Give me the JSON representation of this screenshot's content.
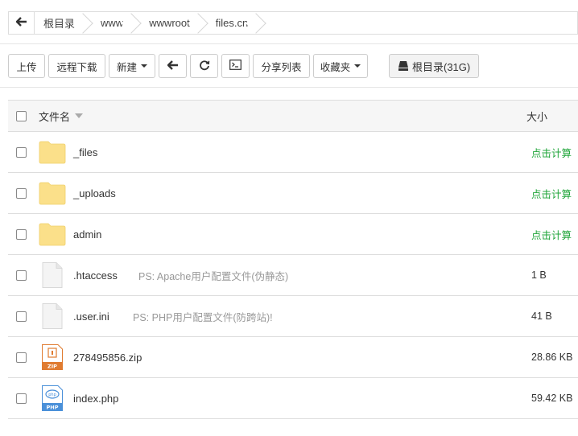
{
  "breadcrumb": {
    "items": [
      "根目录",
      "www",
      "wwwroot",
      "files.cn"
    ]
  },
  "toolbar": {
    "upload": "上传",
    "remote_download": "远程下载",
    "new": "新建",
    "share_list": "分享列表",
    "favorites": "收藏夹",
    "disk": "根目录(31G)"
  },
  "table": {
    "col_name": "文件名",
    "col_size": "大小",
    "rows": [
      {
        "name": "_files",
        "type": "folder",
        "ps": "",
        "size": "点击计算"
      },
      {
        "name": "_uploads",
        "type": "folder",
        "ps": "",
        "size": "点击计算"
      },
      {
        "name": "admin",
        "type": "folder",
        "ps": "",
        "size": "点击计算"
      },
      {
        "name": ".htaccess",
        "type": "file",
        "ps": "PS: Apache用户配置文件(伪静态)",
        "size": "1 B"
      },
      {
        "name": ".user.ini",
        "type": "file",
        "ps": "PS: PHP用户配置文件(防跨站)!",
        "size": "41 B"
      },
      {
        "name": "278495856.zip",
        "type": "zip",
        "ps": "",
        "size": "28.86 KB"
      },
      {
        "name": "index.php",
        "type": "php",
        "ps": "",
        "size": "59.42 KB"
      }
    ]
  },
  "colors": {
    "accent_green": "#20a53a",
    "folder": "#fbe08a",
    "zip": "#e07b30",
    "php": "#4a90d9"
  }
}
